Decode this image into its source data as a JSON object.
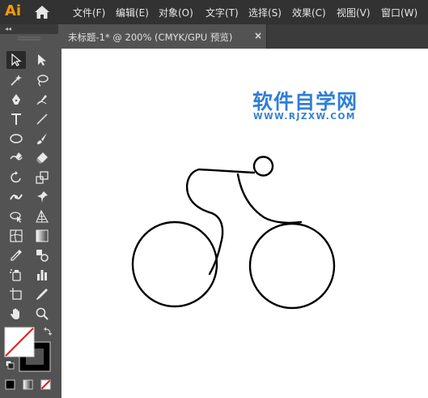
{
  "app": {
    "logo_text": "Ai",
    "icons": {
      "home": "home-icon"
    }
  },
  "menu": {
    "items": [
      {
        "id": "file",
        "label": "文件(F)"
      },
      {
        "id": "edit",
        "label": "编辑(E)"
      },
      {
        "id": "object",
        "label": "对象(O)"
      },
      {
        "id": "type",
        "label": "文字(T)"
      },
      {
        "id": "select",
        "label": "选择(S)"
      },
      {
        "id": "effect",
        "label": "效果(C)"
      },
      {
        "id": "view",
        "label": "视图(V)"
      },
      {
        "id": "window",
        "label": "窗口(W)"
      }
    ]
  },
  "document_tab": {
    "label": "未标题-1* @ 200% (CMYK/GPU 预览)",
    "close_symbol": "×"
  },
  "toolbar": {
    "collapse_symbol": "◂◂",
    "tools": [
      "selection-tool-icon",
      "direct-selection-tool-icon",
      "magic-wand-tool-icon",
      "lasso-tool-icon",
      "pen-tool-icon",
      "curvature-tool-icon",
      "type-tool-icon",
      "line-segment-tool-icon",
      "ellipse-tool-icon",
      "paintbrush-tool-icon",
      "shaper-tool-icon",
      "eraser-tool-icon",
      "rotate-tool-icon",
      "scale-tool-icon",
      "width-tool-icon",
      "puppet-warp-tool-icon",
      "shape-builder-tool-icon",
      "perspective-grid-tool-icon",
      "mesh-tool-icon",
      "gradient-tool-icon",
      "eyedropper-tool-icon",
      "blend-tool-icon",
      "symbol-sprayer-tool-icon",
      "column-graph-tool-icon",
      "artboard-tool-icon",
      "slice-tool-icon",
      "hand-tool-icon",
      "zoom-tool-icon"
    ],
    "colors": {
      "fill": "#ffffff",
      "stroke": "#000000",
      "none_indicator": "#e0201a"
    }
  },
  "canvas": {
    "watermark_title": "软件自学网",
    "watermark_url": "WWW.RJZXW.COM",
    "watermark_color": "#2f7fd6",
    "artwork": "cyclist-outline"
  },
  "colors": {
    "menubar_bg": "#323232",
    "panel_bg": "#535353",
    "canvas_bg": "#ffffff",
    "logo_color": "#ff9a00"
  }
}
